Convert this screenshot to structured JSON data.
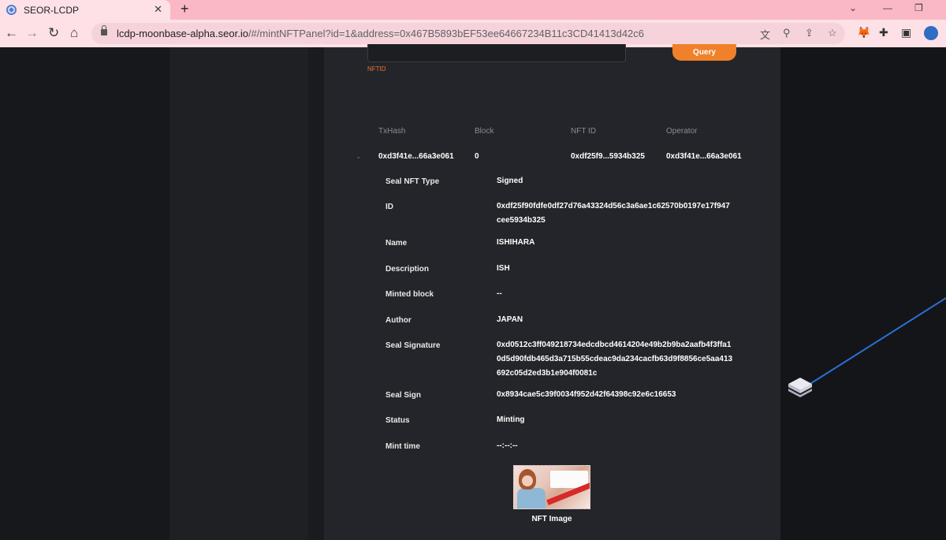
{
  "browser": {
    "tab_title": "SEOR-LCDP",
    "tab_close": "✕",
    "new_tab": "+",
    "url_host": "lcdp-moonbase-alpha.seor.io",
    "url_rest": "/#/mintNFTPanel?id=1&address=0x467B5893bEF53ee64667234B11c3CD41413d42c6"
  },
  "query": {
    "input_value": "",
    "button_label": "Query",
    "field_label": "NFTID"
  },
  "table": {
    "headers": [
      "TxHash",
      "Block",
      "NFT ID",
      "Operator"
    ],
    "row": [
      "0xd3f41e...66a3e061",
      "0",
      "0xdf25f9...5934b325",
      "0xd3f41e...66a3e061"
    ]
  },
  "details": [
    {
      "label": "Seal NFT Type",
      "value": "Signed"
    },
    {
      "label": "ID",
      "value": "0xdf25f90fdfe0df27d76a43324d56c3a6ae1c62570b0197e17f947cee5934b325"
    },
    {
      "label": "Name",
      "value": "ISHIHARA"
    },
    {
      "label": "Description",
      "value": "ISH"
    },
    {
      "label": "Minted block",
      "value": "--"
    },
    {
      "label": "Author",
      "value": "JAPAN"
    },
    {
      "label": "Seal Signature",
      "value": "0xd0512c3ff049218734edcdbcd4614204e49b2b9ba2aafb4f3ffa10d5d90fdb465d3a715b55cdeac9da234cacfb63d9f8856ce5aa413692c05d2ed3b1e904f0081c"
    },
    {
      "label": "Seal Sign",
      "value": "0x8934cae5c39f0034f952d42f64398c92e6c16653"
    },
    {
      "label": "Status",
      "value": "Minting"
    },
    {
      "label": "Mint time",
      "value": "--:--:--"
    }
  ],
  "nft_image_caption": "NFT Image",
  "colors": {
    "accent": "#f0802a",
    "panel": "#24252a",
    "tabbar": "#f9b8c4"
  }
}
